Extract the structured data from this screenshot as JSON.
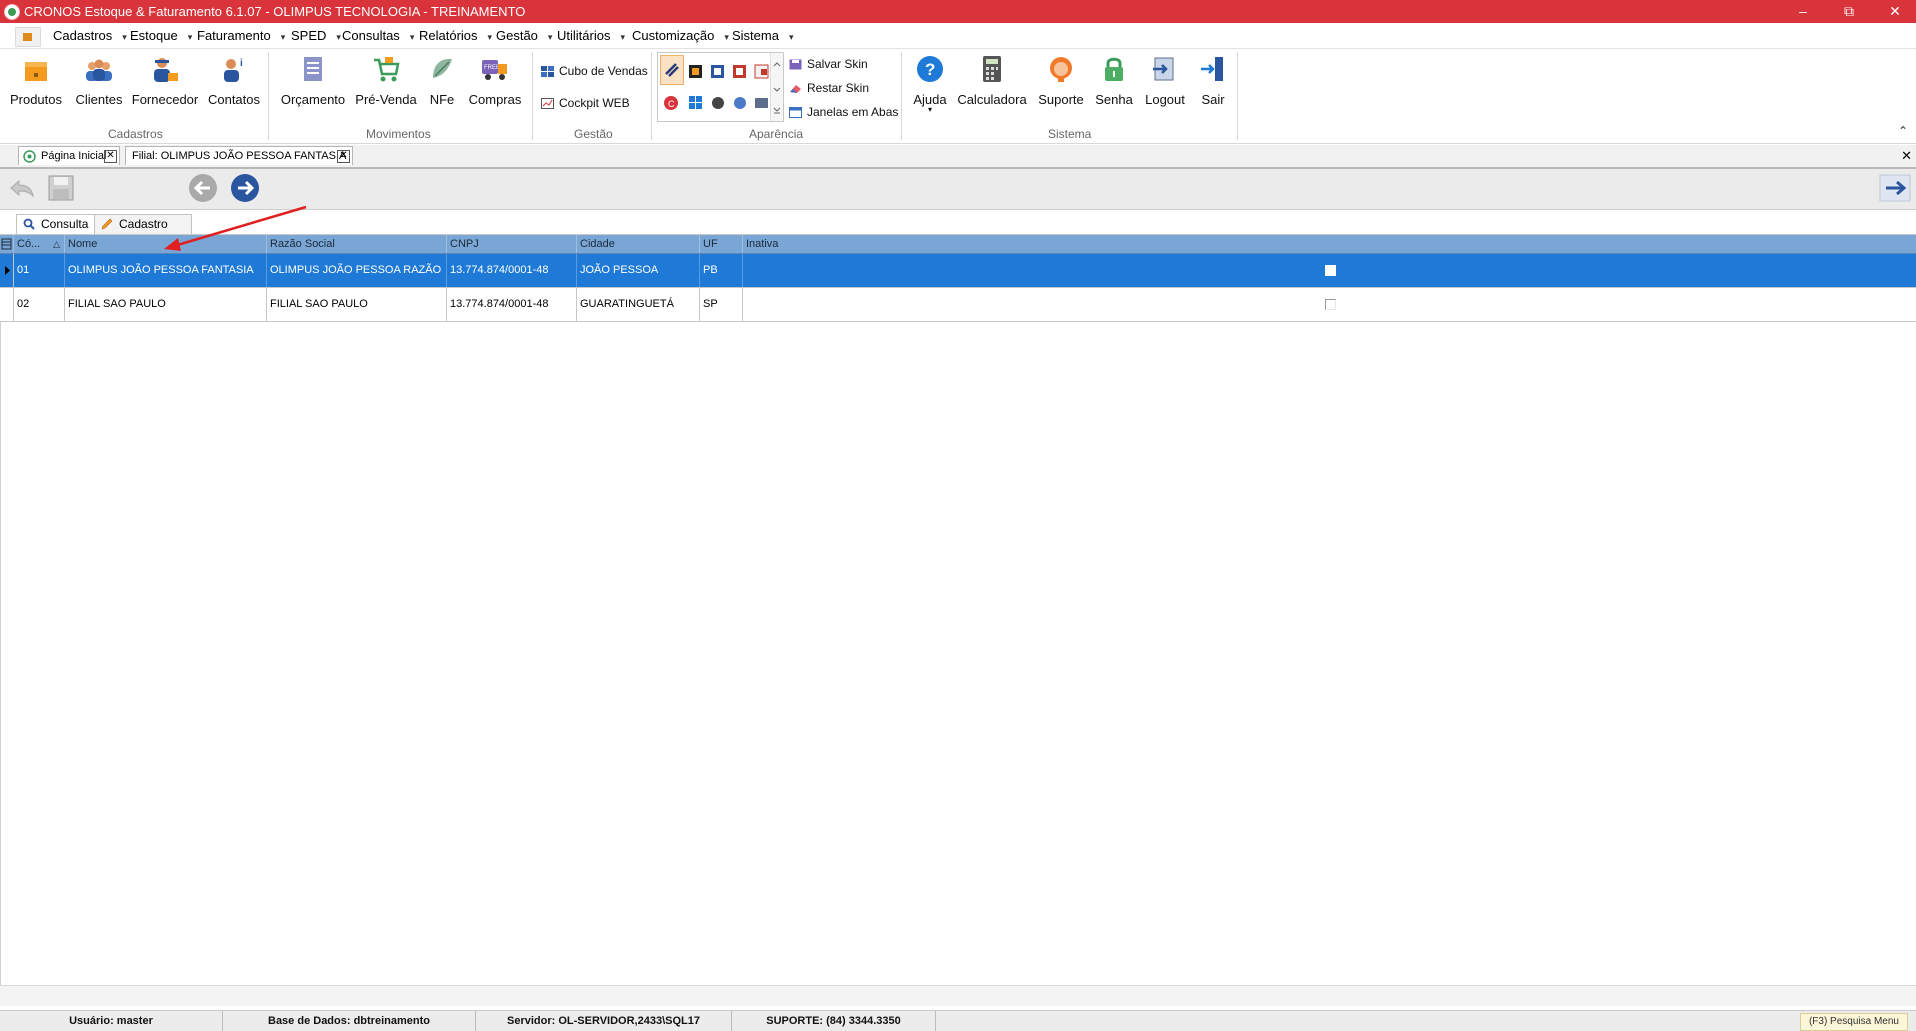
{
  "window": {
    "title": "CRONOS Estoque & Faturamento 6.1.07 - OLIMPUS TECNOLOGIA - TREINAMENTO",
    "controls": [
      "minimize",
      "restore",
      "close"
    ],
    "accent": "#d9343b"
  },
  "menu": {
    "items": [
      {
        "label": "Cadastros"
      },
      {
        "label": "Estoque"
      },
      {
        "label": "Faturamento"
      },
      {
        "label": "SPED"
      },
      {
        "label": "Consultas"
      },
      {
        "label": "Relatórios"
      },
      {
        "label": "Gestão"
      },
      {
        "label": "Utilitários"
      },
      {
        "label": "Customização"
      },
      {
        "label": "Sistema"
      }
    ]
  },
  "ribbon": {
    "cadastros": {
      "label": "Cadastros",
      "buttons": [
        {
          "label": "Produtos",
          "icon": "box-icon"
        },
        {
          "label": "Clientes",
          "icon": "people-icon"
        },
        {
          "label": "Fornecedor",
          "icon": "supplier-icon"
        },
        {
          "label": "Contatos",
          "icon": "contact-icon"
        }
      ]
    },
    "movimentos": {
      "label": "Movimentos",
      "buttons": [
        {
          "label": "Orçamento",
          "icon": "document-list-icon"
        },
        {
          "label": "Pré-Venda",
          "icon": "cart-icon"
        },
        {
          "label": "NFe",
          "icon": "nfe-icon"
        },
        {
          "label": "Compras",
          "icon": "truck-icon"
        }
      ]
    },
    "gestao": {
      "label": "Gestão",
      "buttons": [
        {
          "label": "Cubo de Vendas",
          "icon": "cube-icon"
        },
        {
          "label": "Cockpit WEB",
          "icon": "cockpit-icon"
        }
      ]
    },
    "aparencia": {
      "label": "Aparência",
      "buttons": [
        {
          "label": "Salvar Skin",
          "icon": "save-skin-icon"
        },
        {
          "label": "Restar Skin",
          "icon": "eraser-icon"
        },
        {
          "label": "Janelas em Abas",
          "icon": "tabs-window-icon"
        }
      ]
    },
    "sistema": {
      "label": "Sistema",
      "buttons": [
        {
          "label": "Ajuda",
          "icon": "help-icon"
        },
        {
          "label": "Calculadora",
          "icon": "calculator-icon"
        },
        {
          "label": "Suporte",
          "icon": "support-icon"
        },
        {
          "label": "Senha",
          "icon": "lock-icon"
        },
        {
          "label": "Logout",
          "icon": "logout-icon"
        },
        {
          "label": "Sair",
          "icon": "exit-icon"
        }
      ]
    }
  },
  "doc_tabs": [
    {
      "label": "Página Inicial"
    },
    {
      "label": "Filial: OLIMPUS JOÃO PESSOA FANTASIA"
    }
  ],
  "sub_tabs": [
    {
      "label": "Consulta"
    },
    {
      "label": "Cadastro"
    }
  ],
  "grid": {
    "columns": [
      "Có...",
      "Nome",
      "Razão Social",
      "CNPJ",
      "Cidade",
      "UF",
      "Inativa"
    ],
    "rows": [
      {
        "codigo": "01",
        "nome": "OLIMPUS JOÃO PESSOA FANTASIA",
        "razao": "OLIMPUS JOÃO PESSOA RAZÃO",
        "cnpj": "13.774.874/0001-48",
        "cidade": "JOÃO PESSOA",
        "uf": "PB",
        "inativa": false,
        "selected": true
      },
      {
        "codigo": "02",
        "nome": "FILIAL SAO PAULO",
        "razao": "FILIAL SAO PAULO",
        "cnpj": "13.774.874/0001-48",
        "cidade": "GUARATINGUETÁ",
        "uf": "SP",
        "inativa": false,
        "selected": false
      }
    ],
    "selection_color": "#1e7ad6",
    "header_color": "#7aa6d6"
  },
  "status": {
    "usuario": "Usuário: master",
    "base": "Base de Dados: dbtreinamento",
    "servidor": "Servidor: OL-SERVIDOR,2433\\SQL17",
    "suporte": "SUPORTE: (84) 3344.3350",
    "hint": "(F3) Pesquisa Menu"
  }
}
